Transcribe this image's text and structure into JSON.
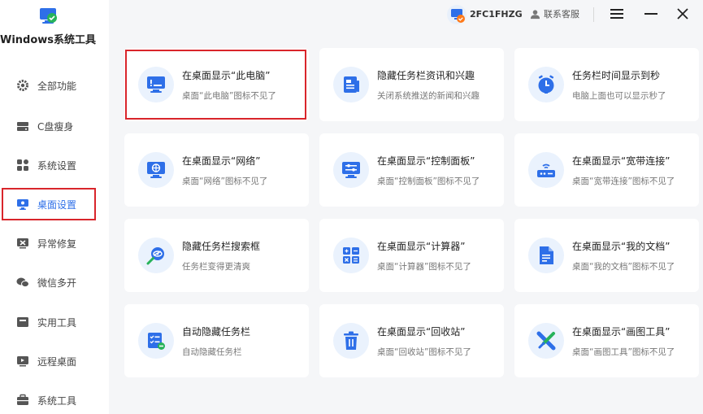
{
  "app": {
    "title": "Windows系统工具"
  },
  "header": {
    "user_id": "2FC1FHZG",
    "support_label": "联系客服"
  },
  "sidebar": {
    "items": [
      {
        "label": "全部功能",
        "icon": "gear-icon"
      },
      {
        "label": "C盘瘦身",
        "icon": "disk-icon"
      },
      {
        "label": "系统设置",
        "icon": "grid-icon"
      },
      {
        "label": "桌面设置",
        "icon": "monitor-icon",
        "active": true
      },
      {
        "label": "异常修复",
        "icon": "repair-icon"
      },
      {
        "label": "微信多开",
        "icon": "chat-icon"
      },
      {
        "label": "实用工具",
        "icon": "toolbox-icon"
      },
      {
        "label": "远程桌面",
        "icon": "remote-icon"
      },
      {
        "label": "系统工具",
        "icon": "briefcase-icon"
      }
    ]
  },
  "cards": [
    {
      "title": "在桌面显示“此电脑”",
      "desc": "桌面“此电脑”图标不见了",
      "icon": "computer-icon"
    },
    {
      "title": "隐藏任务栏资讯和兴趣",
      "desc": "关闭系统推送的新闻和兴趣",
      "icon": "news-icon"
    },
    {
      "title": "任务栏时间显示到秒",
      "desc": "电脑上面也可以显示秒了",
      "icon": "clock-icon"
    },
    {
      "title": "在桌面显示“网络”",
      "desc": "桌面“网络”图标不见了",
      "icon": "network-icon"
    },
    {
      "title": "在桌面显示“控制面板”",
      "desc": "桌面“控制面板”图标不见了",
      "icon": "control-panel-icon"
    },
    {
      "title": "在桌面显示“宽带连接”",
      "desc": "桌面“宽带连接”图标不见了",
      "icon": "router-icon"
    },
    {
      "title": "隐藏任务栏搜索框",
      "desc": "任务栏变得更清爽",
      "icon": "hidden-search-icon"
    },
    {
      "title": "在桌面显示“计算器”",
      "desc": "桌面“计算器”图标不见了",
      "icon": "calculator-icon"
    },
    {
      "title": "在桌面显示“我的文档”",
      "desc": "桌面“我的文档”图标不见了",
      "icon": "document-icon"
    },
    {
      "title": "自动隐藏任务栏",
      "desc": "自动隐藏任务栏",
      "icon": "auto-hide-icon"
    },
    {
      "title": "在桌面显示“回收站”",
      "desc": "桌面“回收站”图标不见了",
      "icon": "recycle-bin-icon"
    },
    {
      "title": "在桌面显示“画图工具”",
      "desc": "桌面“画图工具”图标不见了",
      "icon": "paint-icon"
    }
  ],
  "colors": {
    "accent": "#2e6fe8",
    "highlight": "#d9252b",
    "icon_bg": "#eaf2fd"
  }
}
